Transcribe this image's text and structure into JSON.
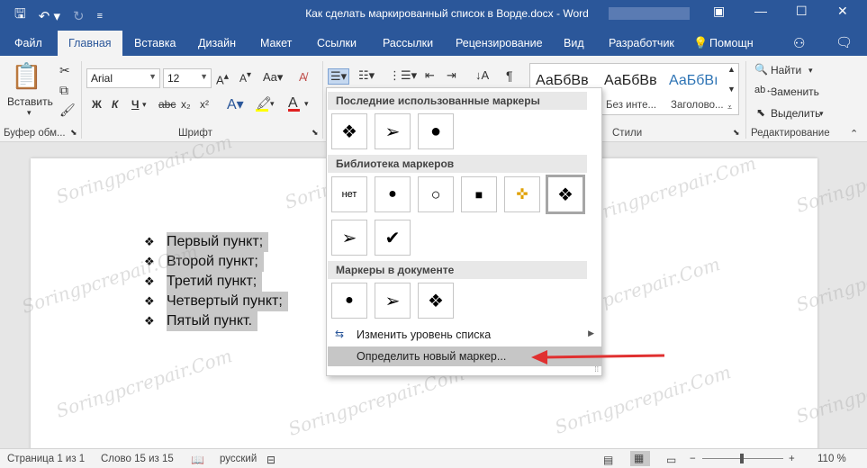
{
  "window": {
    "title": "Как сделать маркированный список в Ворде.docx - Word"
  },
  "tabs": [
    "Файл",
    "Главная",
    "Вставка",
    "Дизайн",
    "Макет",
    "Ссылки",
    "Рассылки",
    "Рецензирование",
    "Вид",
    "Разработчик"
  ],
  "active_tab": "Главная",
  "help": {
    "label": "Помощн"
  },
  "clipboard": {
    "paste_label": "Вставить",
    "group_label": "Буфер обм..."
  },
  "font": {
    "name": "Arial",
    "size": "12",
    "bold": "Ж",
    "italic": "К",
    "underline": "Ч",
    "strike": "abc",
    "subscript": "x₂",
    "superscript": "x²",
    "group_label": "Шрифт"
  },
  "styles": {
    "items": [
      {
        "preview": "АаБбВв",
        "name": ""
      },
      {
        "preview": "АаБбВв",
        "name": "Без инте..."
      },
      {
        "preview": "АаБбВı",
        "name": "Заголово..."
      }
    ],
    "group_label": "Стили"
  },
  "editing": {
    "find": "Найти",
    "replace": "Заменить",
    "select": "Выделить",
    "group_label": "Редактирование"
  },
  "document": {
    "bullet_items": [
      "Первый пункт;",
      "Второй пункт;",
      "Третий пункт;",
      "Четвертый пункт;",
      "Пятый пункт."
    ]
  },
  "dropdown": {
    "recent_header": "Последние использованные маркеры",
    "library_header": "Библиотека маркеров",
    "document_header": "Маркеры в документе",
    "none_label": "нет",
    "change_level": "Изменить уровень списка",
    "define_new": "Определить новый маркер..."
  },
  "watermark": "Soringpcrepair.Com",
  "statusbar": {
    "page": "Страница 1 из 1",
    "words": "Слово 15 из 15",
    "language": "русский",
    "zoom": "110 %"
  }
}
